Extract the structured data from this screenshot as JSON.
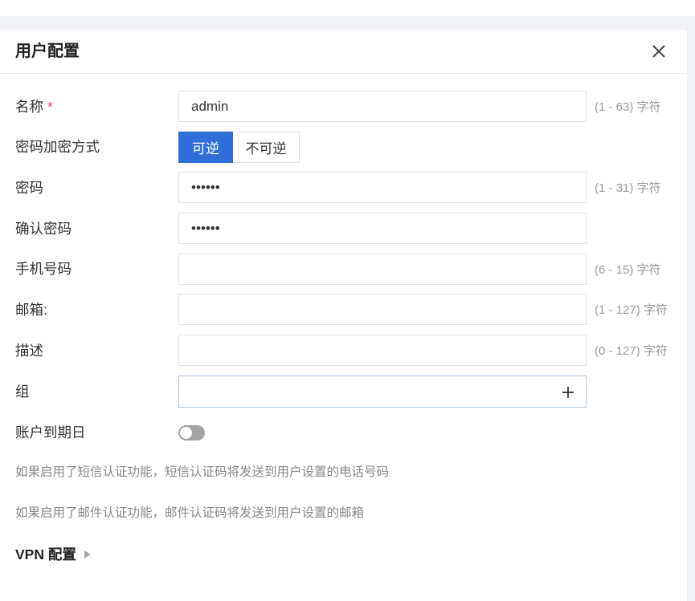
{
  "dialog": {
    "title": "用户配置",
    "close_icon": "close-icon"
  },
  "form": {
    "name": {
      "label": "名称",
      "required_mark": "*",
      "value": "admin",
      "hint": "(1 - 63) 字符"
    },
    "encryption": {
      "label": "密码加密方式",
      "options": [
        "可逆",
        "不可逆"
      ],
      "selected_index": 0
    },
    "password": {
      "label": "密码",
      "value": "••••••",
      "hint": "(1 - 31) 字符"
    },
    "confirm_password": {
      "label": "确认密码",
      "value": "••••••"
    },
    "phone": {
      "label": "手机号码",
      "value": "",
      "hint": "(6 - 15) 字符"
    },
    "email": {
      "label": "邮箱:",
      "value": "",
      "hint": "(1 - 127) 字符"
    },
    "description": {
      "label": "描述",
      "value": "",
      "hint": "(0 - 127) 字符"
    },
    "group": {
      "label": "组",
      "value": "",
      "add_icon": "plus-icon"
    },
    "expiry": {
      "label": "账户到期日",
      "enabled": false
    }
  },
  "notes": {
    "sms": "如果启用了短信认证功能，短信认证码将发送到用户设置的电话号码",
    "email": "如果启用了邮件认证功能，邮件认证码将发送到用户设置的邮箱"
  },
  "vpn_section": {
    "label": "VPN 配置",
    "expand_icon": "caret-right-icon",
    "expanded": false
  },
  "colors": {
    "primary": "#2f6fd7",
    "required": "#e5484d",
    "page_background": "#f0f2f5",
    "group_border": "#a9c3e6"
  }
}
